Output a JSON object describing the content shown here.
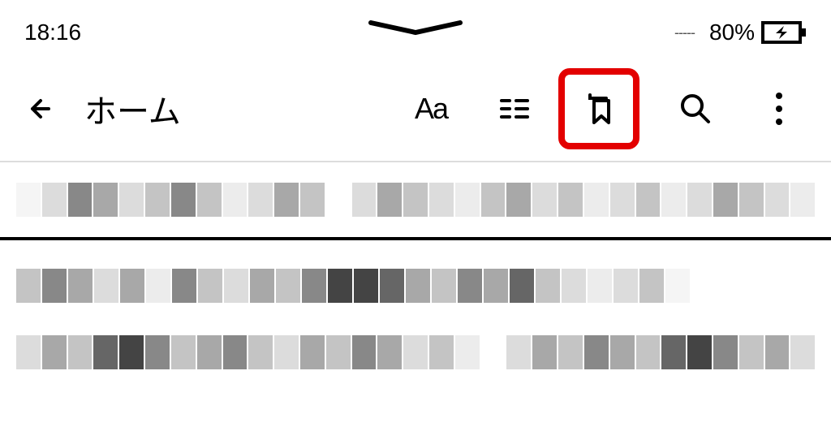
{
  "status": {
    "time": "18:16",
    "battery_pct": "80%",
    "signal": "-----"
  },
  "toolbar": {
    "title": "ホーム",
    "font_label": "Aa"
  },
  "icons": {
    "back": "back-arrow-icon",
    "font": "font-size-icon",
    "list": "list-icon",
    "bookmark": "bookmark-icon",
    "search": "search-icon",
    "more": "more-icon",
    "battery": "battery-charging-icon",
    "notch": "notch-chevron-icon"
  }
}
